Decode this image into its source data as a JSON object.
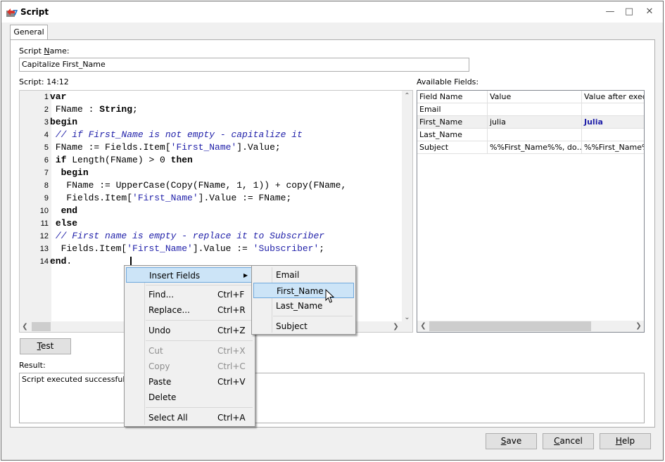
{
  "window": {
    "title": "Script",
    "controls": {
      "minimize": "—",
      "maximize": "□",
      "close": "✕"
    }
  },
  "tabs": [
    {
      "label": "General",
      "active": true
    }
  ],
  "script_name": {
    "label": "Script Name:",
    "value": "Capitalize First_Name"
  },
  "script_status": "Script: 14:12",
  "code_lines": [
    {
      "n": "1",
      "html": "<span class='kw'>var</span>"
    },
    {
      "n": "2",
      "html": " FName : <span class='kw'>String</span>;"
    },
    {
      "n": "3",
      "html": "<span class='kw'>begin</span>"
    },
    {
      "n": "4",
      "html": " <span class='cm'>// if First_Name is not empty - capitalize it</span>"
    },
    {
      "n": "5",
      "html": " FName := Fields.Item[<span class='st'>'First_Name'</span>].Value;"
    },
    {
      "n": "6",
      "html": " <span class='kw'>if</span> Length(FName) > 0 <span class='kw'>then</span>"
    },
    {
      "n": "7",
      "html": "  <span class='kw'>begin</span>"
    },
    {
      "n": "8",
      "html": "   FName := UpperCase(Copy(FName, 1, 1)) + copy(FName,"
    },
    {
      "n": "9",
      "html": "   Fields.Item[<span class='st'>'First_Name'</span>].Value := FName;"
    },
    {
      "n": "10",
      "html": "  <span class='kw'>end</span>"
    },
    {
      "n": "11",
      "html": " <span class='kw'>else</span>"
    },
    {
      "n": "12",
      "html": " <span class='cm'>// First name is empty - replace it to Subscriber</span>"
    },
    {
      "n": "13",
      "html": "  Fields.Item[<span class='st'>'First_Name'</span>].Value := <span class='st'>'Subscriber'</span>;"
    },
    {
      "n": "14",
      "html": "<span class='kw'>end</span>."
    }
  ],
  "available_fields": {
    "label": "Available Fields:",
    "columns": [
      "Field Name",
      "Value",
      "Value after execu"
    ],
    "rows": [
      [
        "Email",
        "",
        ""
      ],
      [
        "First_Name",
        "julia",
        "Julia"
      ],
      [
        "Last_Name",
        "",
        ""
      ],
      [
        "Subject",
        "%%First_Name%%, do…",
        "%%First_Name%"
      ]
    ],
    "highlight_row": 1,
    "changed_value_color": "#1e1ea8"
  },
  "test_button": "Test",
  "result": {
    "label": "Result:",
    "text": "Script executed successfully"
  },
  "footer": {
    "save": "Save",
    "cancel": "Cancel",
    "help": "Help"
  },
  "context_menu": {
    "items": [
      {
        "label": "Insert Fields",
        "shortcut": "",
        "submenu": true,
        "highlighted": true
      },
      {
        "label": "Find...",
        "shortcut": "Ctrl+F"
      },
      {
        "label": "Replace...",
        "shortcut": "Ctrl+R"
      },
      {
        "label": "Undo",
        "shortcut": "Ctrl+Z"
      },
      {
        "label": "Cut",
        "shortcut": "Ctrl+X",
        "disabled": true
      },
      {
        "label": "Copy",
        "shortcut": "Ctrl+C",
        "disabled": true
      },
      {
        "label": "Paste",
        "shortcut": "Ctrl+V"
      },
      {
        "label": "Delete",
        "shortcut": ""
      },
      {
        "label": "Select All",
        "shortcut": "Ctrl+A"
      }
    ],
    "submenu": [
      {
        "label": "Email"
      },
      {
        "label": "First_Name",
        "highlighted": true
      },
      {
        "label": "Last_Name"
      },
      {
        "label": "Subject"
      }
    ]
  },
  "colors": {
    "menu_highlight": "#cce4f7",
    "menu_highlight_border": "#6fa8dc",
    "code_string": "#1e1ea8"
  }
}
